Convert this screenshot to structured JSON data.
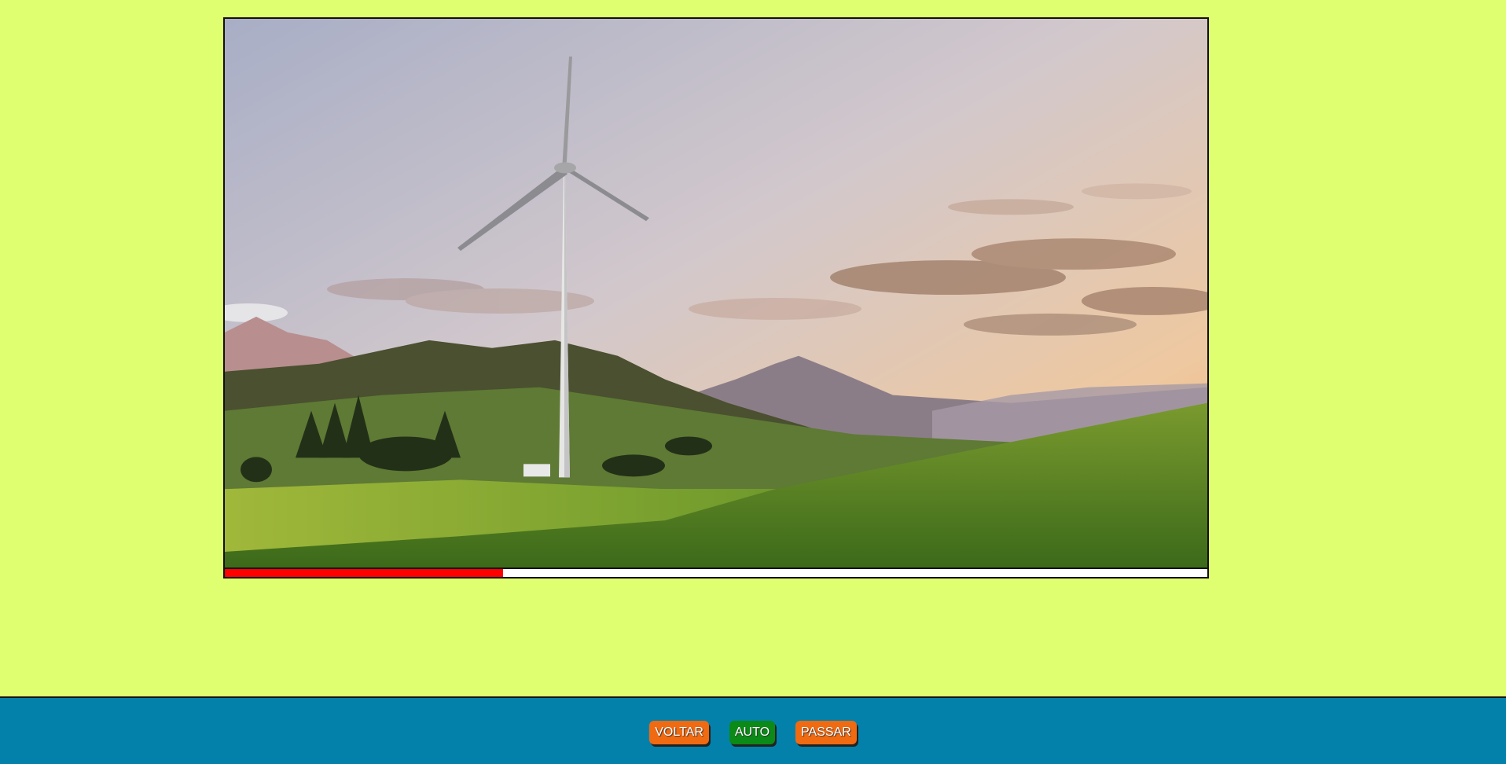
{
  "slideshow": {
    "image_alt": "wind-turbine-in-mountain-field",
    "progress_percent": 28.3,
    "progress_color": "#ff0000"
  },
  "controls": {
    "back_label": "VOLTAR",
    "auto_label": "AUTO",
    "next_label": "PASSAR"
  },
  "colors": {
    "page_background": "#e0ff70",
    "footer_background": "#0481ab",
    "button_orange": "#f06a12",
    "button_green": "#0b8a17"
  }
}
